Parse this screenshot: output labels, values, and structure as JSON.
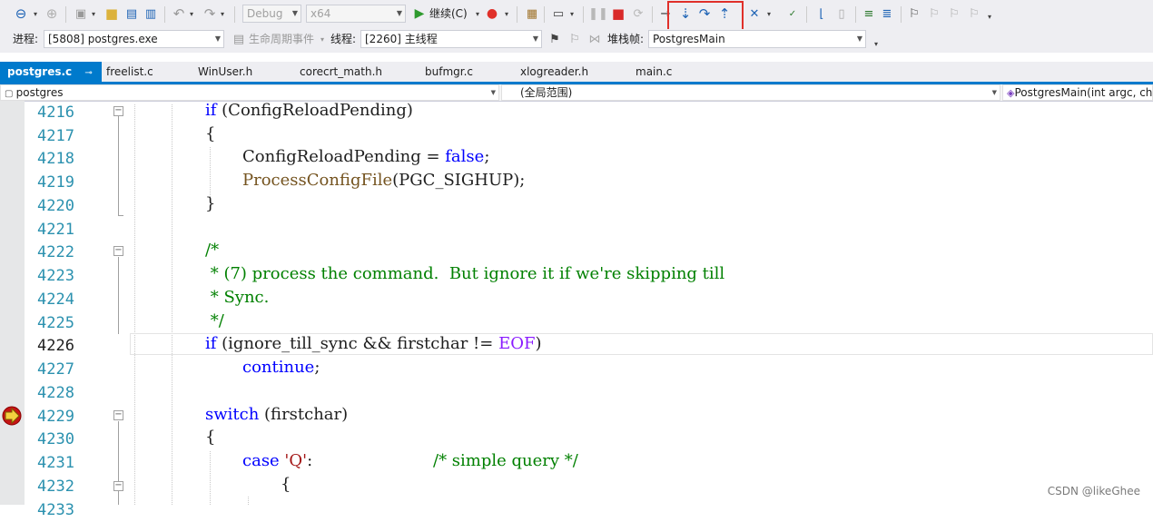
{
  "toolbar": {
    "config": "Debug",
    "platform": "x64",
    "continue_label": "继续(C)"
  },
  "debug_bar": {
    "process_label": "进程:",
    "process_value": "[5808] postgres.exe",
    "lifecycle_label": "生命周期事件",
    "thread_label": "线程:",
    "thread_value": "[2260] 主线程",
    "stack_label": "堆栈帧:",
    "stack_value": "PostgresMain"
  },
  "tabs": [
    {
      "label": "postgres.c",
      "active": true,
      "pin": "⊸ ×"
    },
    {
      "label": "freelist.c"
    },
    {
      "label": "WinUser.h"
    },
    {
      "label": "corecrt_math.h"
    },
    {
      "label": "bufmgr.c"
    },
    {
      "label": "xlogreader.h"
    },
    {
      "label": "main.c"
    }
  ],
  "navbar": {
    "project": "postgres",
    "scope": "(全局范围)",
    "function": "PostgresMain(int argc, ch"
  },
  "editor": {
    "line_numbers": [
      "4216",
      "4217",
      "4218",
      "4219",
      "4220",
      "4221",
      "4222",
      "4223",
      "4224",
      "4225",
      "4226",
      "4227",
      "4228",
      "4229",
      "4230",
      "4231",
      "4232",
      "4233"
    ],
    "current_line": "4226",
    "breakpoint_line": "4229"
  },
  "code": {
    "l4216_kw": "if",
    "l4216_rest": " (ConfigReloadPending)",
    "l4217": "{",
    "l4218_a": "ConfigReloadPending = ",
    "l4218_kw": "false",
    "l4218_b": ";",
    "l4219_fn": "ProcessConfigFile",
    "l4219_rest": "(PGC_SIGHUP);",
    "l4220": "}",
    "l4222": "/*",
    "l4223": " * (7) process the command.  But ignore it if we're skipping till",
    "l4224": " * Sync.",
    "l4225": " */",
    "l4226_kw": "if",
    "l4226_a": " (ignore_till_sync && firstchar != ",
    "l4226_mac": "EOF",
    "l4226_b": ")",
    "l4227_kw": "continue",
    "l4227_b": ";",
    "l4229_kw": "switch",
    "l4229_rest": " (firstchar)",
    "l4230": "{",
    "l4231_kw": "case",
    "l4231_st": " 'Q'",
    "l4231_b": ":",
    "l4231_cm": "/* simple query */",
    "l4232": "{"
  },
  "watermark": "CSDN @likeGhee",
  "colors": {
    "accent": "#007acc",
    "keyword": "#0000ff",
    "comment": "#008000",
    "highlight": "#e0302a"
  }
}
